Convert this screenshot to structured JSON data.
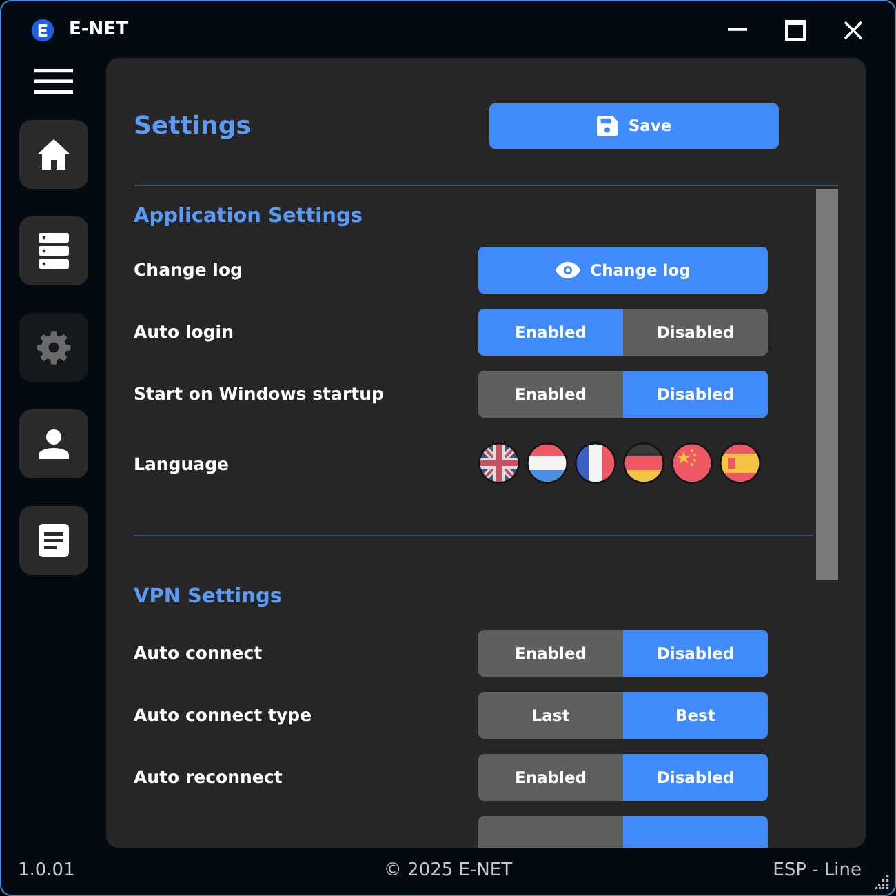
{
  "window": {
    "title": "E-NET"
  },
  "sidebar": {
    "items": [
      {
        "kind": "home",
        "selected": false
      },
      {
        "kind": "servers",
        "selected": false
      },
      {
        "kind": "settings",
        "selected": true
      },
      {
        "kind": "account",
        "selected": false
      },
      {
        "kind": "log",
        "selected": false
      }
    ]
  },
  "page": {
    "title": "Settings",
    "save_button": "Save"
  },
  "sections": [
    {
      "title": "Application Settings",
      "rows": [
        {
          "kind": "button",
          "label": "Change log",
          "button": "Change log"
        },
        {
          "kind": "toggle",
          "label": "Auto login",
          "options": [
            {
              "label": "Enabled",
              "selected": true
            },
            {
              "label": "Disabled",
              "selected": false
            }
          ]
        },
        {
          "kind": "toggle",
          "label": "Start on Windows startup",
          "options": [
            {
              "label": "Enabled",
              "selected": false
            },
            {
              "label": "Disabled",
              "selected": true
            }
          ]
        },
        {
          "kind": "flags",
          "label": "Language",
          "flags": [
            {
              "kind": "uk"
            },
            {
              "kind": "nl"
            },
            {
              "kind": "fr"
            },
            {
              "kind": "de"
            },
            {
              "kind": "cn"
            },
            {
              "kind": "es"
            }
          ]
        }
      ]
    },
    {
      "title": "VPN Settings",
      "rows": [
        {
          "kind": "toggle",
          "label": "Auto connect",
          "options": [
            {
              "label": "Enabled",
              "selected": false
            },
            {
              "label": "Disabled",
              "selected": true
            }
          ]
        },
        {
          "kind": "toggle",
          "label": "Auto connect type",
          "options": [
            {
              "label": "Last",
              "selected": false
            },
            {
              "label": "Best",
              "selected": true
            }
          ]
        },
        {
          "kind": "toggle",
          "label": "Auto reconnect",
          "options": [
            {
              "label": "Enabled",
              "selected": false
            },
            {
              "label": "Disabled",
              "selected": true
            }
          ]
        },
        {
          "kind": "toggle",
          "options": [
            {
              "selected": false
            },
            {
              "selected": true
            }
          ]
        }
      ]
    }
  ],
  "status_bar": {
    "version": "1.0.01",
    "copyright": "© 2025 E-NET",
    "mode": "ESP - Line"
  }
}
